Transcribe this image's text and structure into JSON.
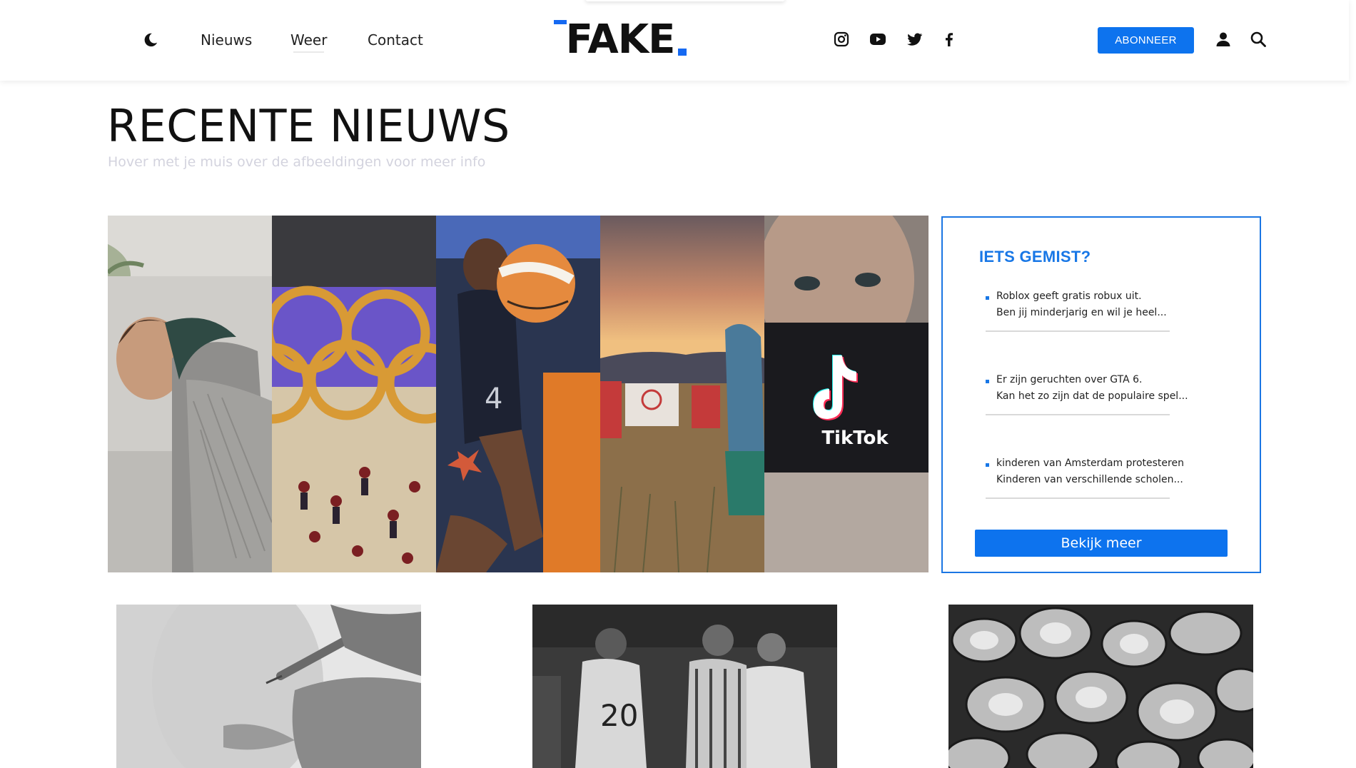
{
  "header": {
    "logo_text": "FAKE",
    "nav": [
      {
        "label": "Nieuws"
      },
      {
        "label": "Weer"
      },
      {
        "label": "Contact"
      }
    ],
    "social_icons": [
      "instagram-icon",
      "youtube-icon",
      "twitter-icon",
      "facebook-icon"
    ],
    "subscribe_label": "ABONNEER",
    "colors": {
      "accent": "#0d73ee",
      "logo_accent": "#1569f2"
    }
  },
  "main": {
    "title": "RECENTE NIEUWS",
    "subtitle": "Hover met je muis over de afbeeldingen voor meer info",
    "gallery": [
      {
        "alt": "sleeping-woman-photo"
      },
      {
        "alt": "olympic-rings-ceremony-photo"
      },
      {
        "alt": "basketball-player-photo"
      },
      {
        "alt": "desert-sunset-photo"
      },
      {
        "alt": "tiktok-phone-photo",
        "logo_text": "TikTok"
      }
    ]
  },
  "missed": {
    "title": "IETS GEMIST?",
    "items": [
      {
        "line1": "Roblox geeft gratis robux uit.",
        "line2": "Ben jij minderjarig en wil je heel..."
      },
      {
        "line1": "Er zijn geruchten over GTA 6.",
        "line2": "Kan het zo zijn dat de populaire spel..."
      },
      {
        "line1": "kinderen van Amsterdam protesteren",
        "line2": "Kinderen van verschillende scholen..."
      }
    ],
    "more_label": "Bekijk meer"
  },
  "cards": [
    {
      "alt": "injection-photo"
    },
    {
      "alt": "basketball-team-photo"
    },
    {
      "alt": "cans-photo"
    }
  ]
}
